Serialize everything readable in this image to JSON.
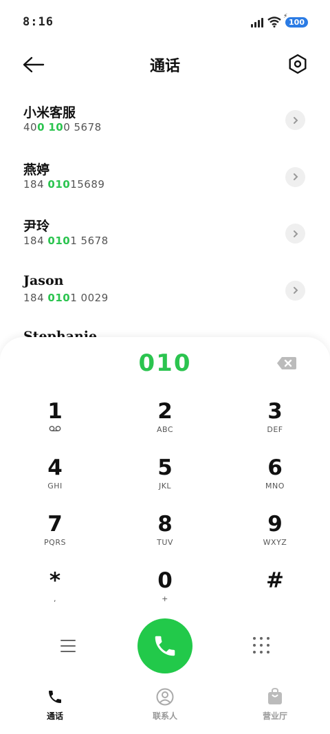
{
  "status_bar": {
    "time": "8:16",
    "battery": "100",
    "icons": [
      "signal-icon",
      "wifi-icon",
      "battery-icon"
    ]
  },
  "header": {
    "title": "通话",
    "back_icon": "back-arrow-icon",
    "settings_icon": "settings-hexagon-icon"
  },
  "contacts": [
    {
      "name": "小米客服",
      "number_pre": "40",
      "number_hl1": "0",
      "number_mid": " ",
      "number_hl2": "10",
      "number_post": "0 5678"
    },
    {
      "name": "燕婷",
      "number_pre": "184 ",
      "number_hl1": "010",
      "number_mid": "",
      "number_hl2": "",
      "number_post": "15689"
    },
    {
      "name": "尹玲",
      "number_pre": "184 ",
      "number_hl1": "010",
      "number_mid": "",
      "number_hl2": "",
      "number_post": "1 5678"
    },
    {
      "name": "Jason",
      "number_pre": "184 ",
      "number_hl1": "010",
      "number_mid": "",
      "number_hl2": "",
      "number_post": "1 0029"
    },
    {
      "name": "Stephanie",
      "number_pre": "",
      "number_hl1": "",
      "number_mid": "",
      "number_hl2": "",
      "number_post": ""
    }
  ],
  "dialer": {
    "input": "010",
    "delete_icon": "backspace-icon",
    "keys": [
      [
        {
          "digit": "1",
          "letters": "voicemail"
        },
        {
          "digit": "2",
          "letters": "ABC"
        },
        {
          "digit": "3",
          "letters": "DEF"
        }
      ],
      [
        {
          "digit": "4",
          "letters": "GHI"
        },
        {
          "digit": "5",
          "letters": "JKL"
        },
        {
          "digit": "6",
          "letters": "MNO"
        }
      ],
      [
        {
          "digit": "7",
          "letters": "PQRS"
        },
        {
          "digit": "8",
          "letters": "TUV"
        },
        {
          "digit": "9",
          "letters": "WXYZ"
        }
      ],
      [
        {
          "digit": "*",
          "letters": ","
        },
        {
          "digit": "0",
          "letters": "+"
        },
        {
          "digit": "#",
          "letters": ""
        }
      ]
    ],
    "call_icon": "phone-icon",
    "menu_icon": "menu-icon",
    "keypad_icon": "keypad-grid-icon"
  },
  "bottom_nav": [
    {
      "label": "通话",
      "icon": "phone-icon",
      "active": true
    },
    {
      "label": "联系人",
      "icon": "person-icon",
      "active": false
    },
    {
      "label": "营业厅",
      "icon": "store-bag-icon",
      "active": false
    }
  ],
  "colors": {
    "accent_green": "#22c94a",
    "highlight_green": "#2bc44f",
    "battery_blue": "#2b7be4"
  }
}
